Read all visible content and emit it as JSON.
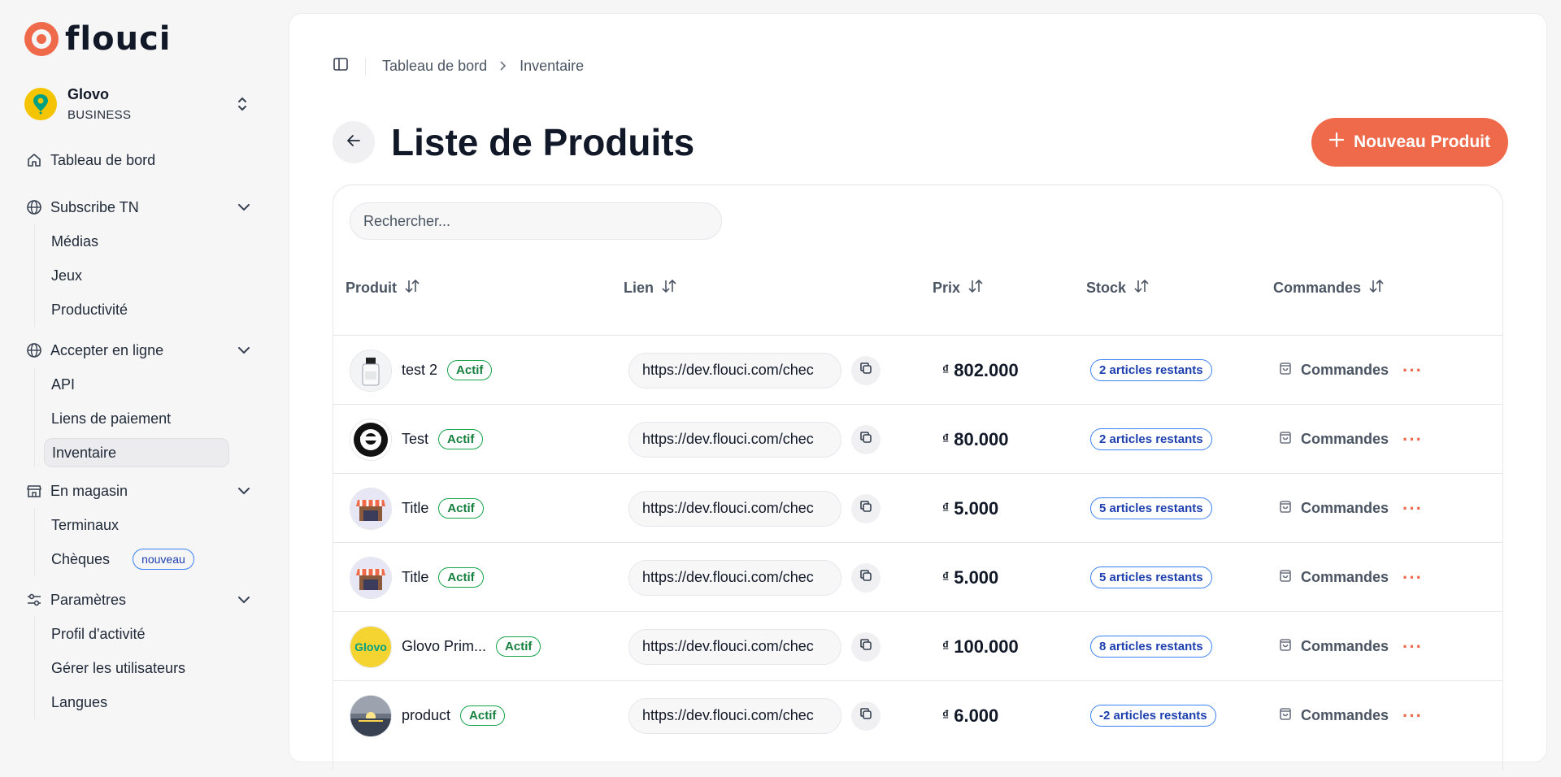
{
  "brand": {
    "name": "flouci",
    "accent": "#ef6a4a"
  },
  "org": {
    "name": "Glovo",
    "type": "BUSINESS"
  },
  "nav": {
    "dashboard": "Tableau de bord",
    "groups": [
      {
        "label": "Subscribe TN",
        "icon": "globe-icon",
        "items": [
          "Médias",
          "Jeux",
          "Productivité"
        ]
      },
      {
        "label": "Accepter en ligne",
        "icon": "globe-icon",
        "items": [
          "API",
          "Liens de paiement",
          "Inventaire"
        ]
      },
      {
        "label": "En magasin",
        "icon": "store-icon",
        "items": [
          "Terminaux",
          "Chèques"
        ]
      },
      {
        "label": "Paramètres",
        "icon": "sliders-icon",
        "items": [
          "Profil d'activité",
          "Gérer les utilisateurs",
          "Langues"
        ]
      }
    ],
    "new_badge": "nouveau"
  },
  "breadcrumb": {
    "parent": "Tableau de bord",
    "current": "Inventaire"
  },
  "page": {
    "title": "Liste de Produits",
    "new_button": "Nouveau Produit"
  },
  "search": {
    "placeholder": "Rechercher..."
  },
  "columns": {
    "product": "Produit",
    "link": "Lien",
    "price": "Prix",
    "stock": "Stock",
    "orders": "Commandes"
  },
  "rows": [
    {
      "name": "test 2",
      "status": "Actif",
      "link": "https://dev.flouci.com/chec",
      "price": "802.000",
      "stock": "2 articles restants",
      "orders": "Commandes",
      "thumb": "bottle"
    },
    {
      "name": "Test",
      "status": "Actif",
      "link": "https://dev.flouci.com/chec",
      "price": "80.000",
      "stock": "2 articles restants",
      "orders": "Commandes",
      "thumb": "emblem"
    },
    {
      "name": "Title",
      "status": "Actif",
      "link": "https://dev.flouci.com/chec",
      "price": "5.000",
      "stock": "5 articles restants",
      "orders": "Commandes",
      "thumb": "shop"
    },
    {
      "name": "Title",
      "status": "Actif",
      "link": "https://dev.flouci.com/chec",
      "price": "5.000",
      "stock": "5 articles restants",
      "orders": "Commandes",
      "thumb": "shop"
    },
    {
      "name": "Glovo Prim...",
      "status": "Actif",
      "link": "https://dev.flouci.com/chec",
      "price": "100.000",
      "stock": "8 articles restants",
      "orders": "Commandes",
      "thumb": "glovo"
    },
    {
      "name": "product",
      "status": "Actif",
      "link": "https://dev.flouci.com/chec",
      "price": "6.000",
      "stock": "-2 articles restants",
      "orders": "Commandes",
      "thumb": "sunset"
    }
  ],
  "currency_symbol": "₫"
}
